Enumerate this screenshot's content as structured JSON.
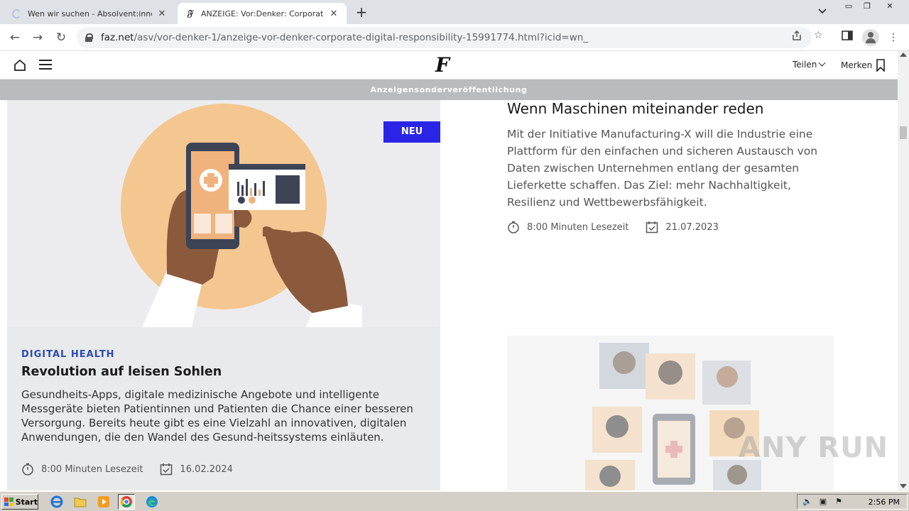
{
  "browser": {
    "tabs": [
      {
        "title": "Wen wir suchen - Absolvent:innen | Wen wir suchen - Absolvent:innen | D",
        "favicon": "loading-spinner",
        "active": false
      },
      {
        "title": "ANZEIGE: Vor:Denker: Corporate Digital Responsibility",
        "favicon": "faz-logo",
        "active": true
      }
    ],
    "new_tab_label": "+",
    "url_domain": "faz.net",
    "url_path": "/asv/vor-denker-1/anzeige-vor-denker-corporate-digital-responsibility-15991774.html?icid=wn_"
  },
  "site": {
    "logo": "F",
    "share_label": "Teilen",
    "bookmark_label": "Merken",
    "ad_banner": "Anzeigensonderveröffentlichung"
  },
  "left_card": {
    "badge": "NEU",
    "kicker": "DIGITAL HEALTH",
    "title": "Revolution auf leisen Sohlen",
    "text": "Gesundheits-Apps, digitale medizinische Angebote und intelligente Messgeräte bieten Patientinnen und Patienten die Chance einer besseren Versorgung. Bereits heute gibt es eine Vielzahl an innovativen, digitalen Anwendungen, die den Wandel des Gesund-heitssystems einläuten.",
    "reading_time": "8:00 Minuten Lesezeit",
    "date": "16.02.2024"
  },
  "right_article": {
    "title": "Wenn Maschinen miteinander reden",
    "text": "Mit der Initiative Manufacturing-X will die Industrie eine Plattform für den einfachen und sicheren Austausch von Daten zwischen Unternehmen entlang der gesamten Lieferkette schaffen. Das Ziel: mehr Nachhaltigkeit, Resilienz und Wettbewerbsfähigkeit.",
    "reading_time": "8:00 Minuten Lesezeit",
    "date": "21.07.2023"
  },
  "watermark": "ANY RUN",
  "taskbar": {
    "start_label": "Start",
    "clock": "2:56 PM"
  },
  "colors": {
    "badge": "#2a25e6",
    "kicker": "#2b4bb5",
    "ad_banner": "#b9bcbf"
  }
}
